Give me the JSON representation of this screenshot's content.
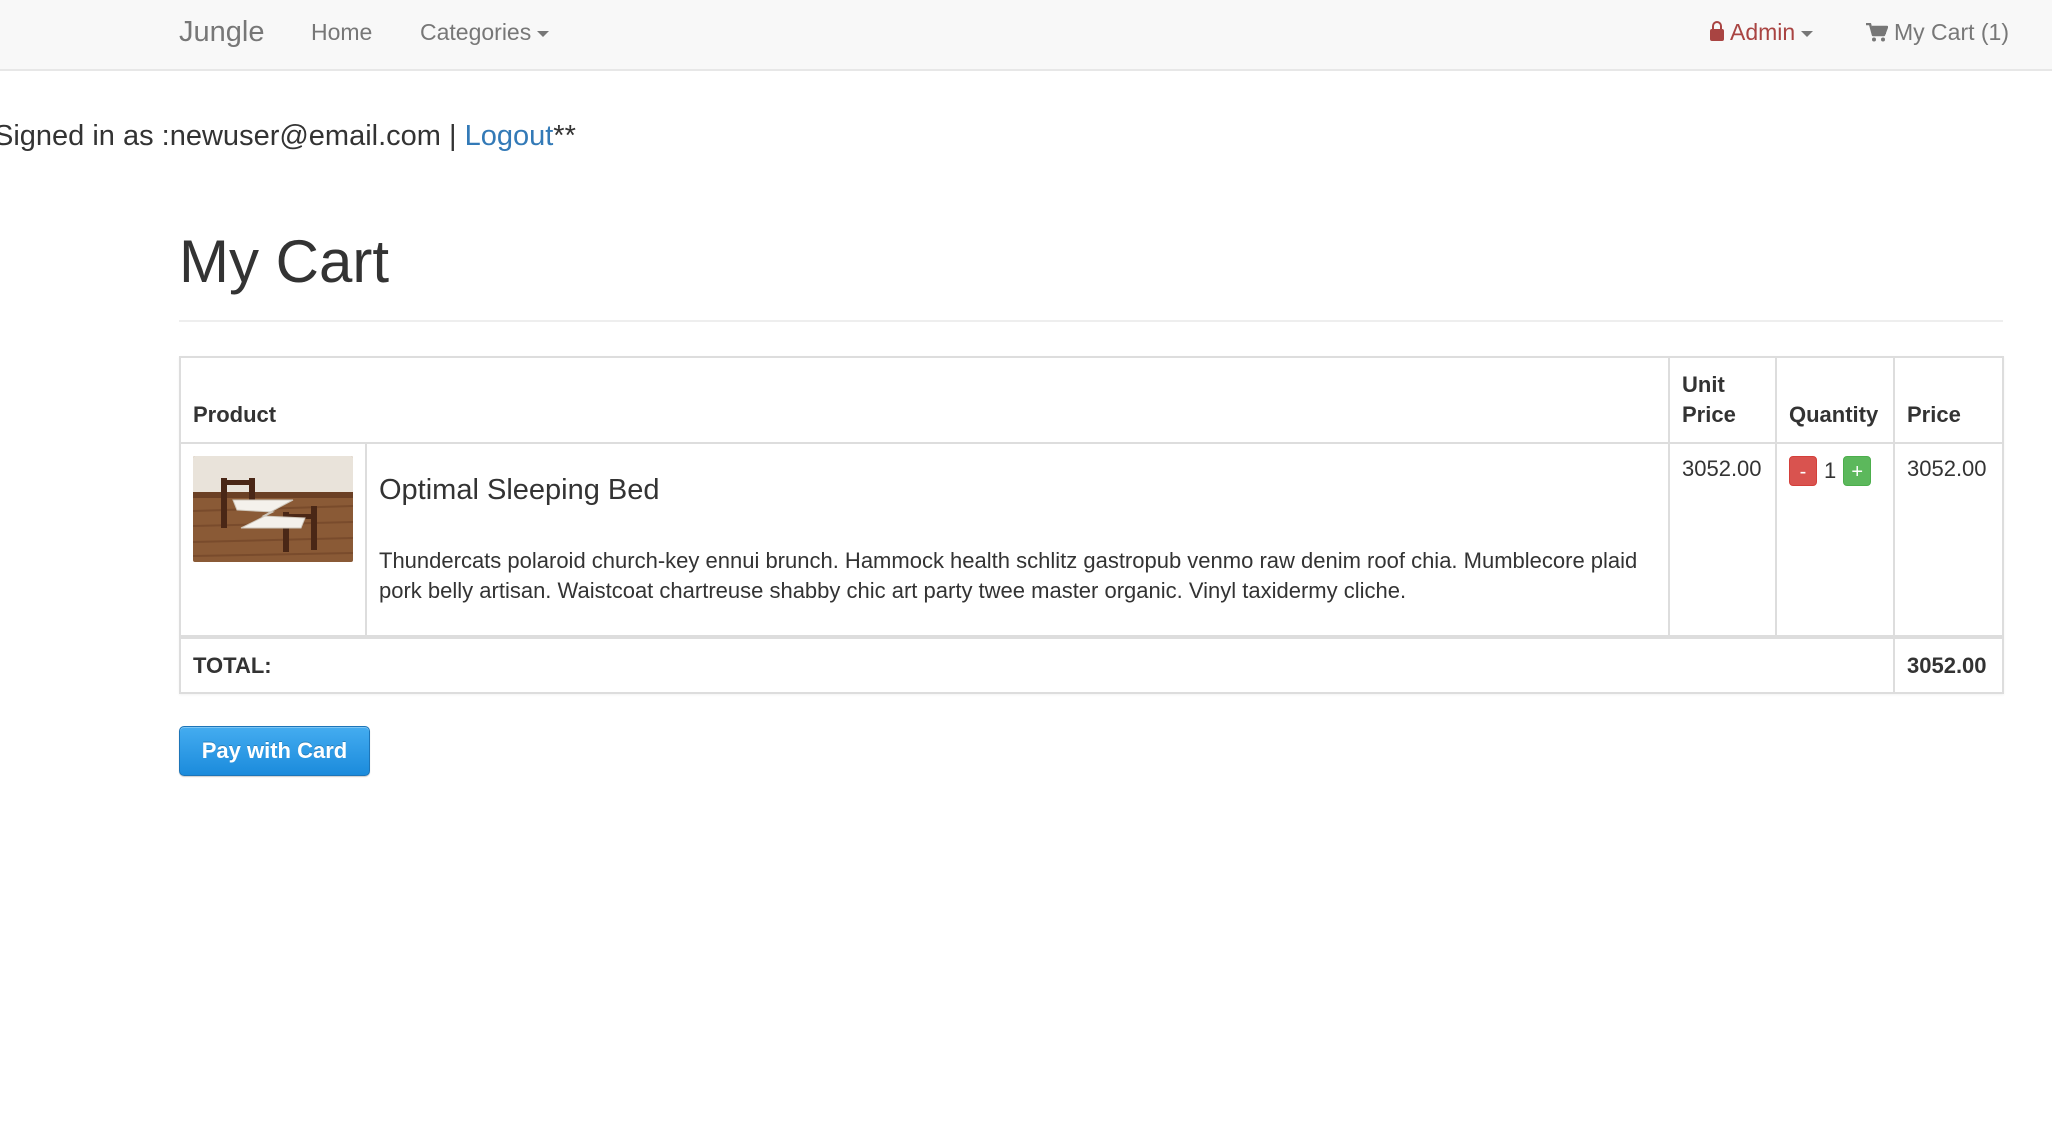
{
  "navbar": {
    "brand": "Jungle",
    "home": "Home",
    "categories": "Categories",
    "admin": "Admin",
    "cart": "My Cart (1)"
  },
  "session": {
    "prefix": "Signed in as :",
    "email": "newuser@email.com",
    "separator": " | ",
    "logout": "Logout",
    "suffix": "**"
  },
  "page": {
    "title": "My Cart"
  },
  "cart": {
    "headers": {
      "product": "Product",
      "unit_price": "Unit Price",
      "quantity": "Quantity",
      "price": "Price"
    },
    "items": [
      {
        "name": "Optimal Sleeping Bed",
        "description": "Thundercats polaroid church-key ennui brunch. Hammock health schlitz gastropub venmo raw denim roof chia. Mumblecore plaid pork belly artisan. Waistcoat chartreuse shabby chic art party twee master organic. Vinyl taxidermy cliche.",
        "unit_price": "3052.00",
        "quantity": "1",
        "minus_label": "-",
        "plus_label": "+",
        "price": "3052.00",
        "image_icon": "bed-photo"
      }
    ],
    "total_label": "TOTAL:",
    "total": "3052.00"
  },
  "payment": {
    "button_label": "Pay with Card"
  },
  "colors": {
    "navbar_bg": "#f8f8f8",
    "link": "#337ab7",
    "admin": "#a94442",
    "danger": "#d9534f",
    "success": "#5cb85c",
    "pay_button": "#1b8bdc"
  }
}
